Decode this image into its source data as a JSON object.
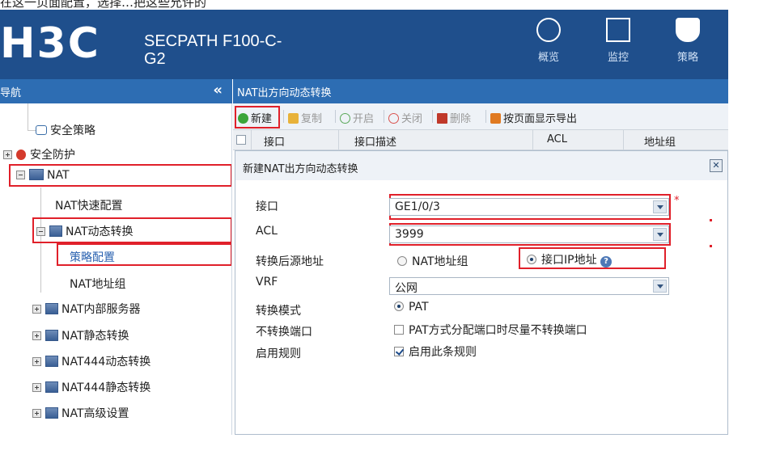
{
  "top_text": "在这一页面配置，选择…把这些允许的",
  "header": {
    "logo": "H3C",
    "product_line1": "SECPATH F100-C-",
    "product_line2": "G2",
    "nav": [
      {
        "label": "概览",
        "icon": "gauge-icon"
      },
      {
        "label": "监控",
        "icon": "monitor-icon"
      },
      {
        "label": "策略",
        "icon": "shield-icon"
      }
    ]
  },
  "sidebar": {
    "title": "导航",
    "collapse_glyph": "«",
    "items": [
      {
        "label": "安全策略"
      },
      {
        "label": "安全防护"
      },
      {
        "label": "NAT"
      },
      {
        "label": "NAT快速配置"
      },
      {
        "label": "NAT动态转换"
      },
      {
        "label": "策略配置"
      },
      {
        "label": "NAT地址组"
      },
      {
        "label": "NAT内部服务器"
      },
      {
        "label": "NAT静态转换"
      },
      {
        "label": "NAT444动态转换"
      },
      {
        "label": "NAT444静态转换"
      },
      {
        "label": "NAT高级设置"
      }
    ]
  },
  "main": {
    "title": "NAT出方向动态转换",
    "toolbar": {
      "new": "新建",
      "copy": "复制",
      "enable": "开启",
      "disable": "关闭",
      "delete": "删除",
      "export": "按页面显示导出"
    },
    "columns": [
      "接口",
      "接口描述",
      "ACL",
      "地址组"
    ]
  },
  "dialog": {
    "title": "新建NAT出方向动态转换",
    "close": "✕",
    "required_mark": "*",
    "fields": {
      "interface": {
        "label": "接口",
        "value": "GE1/0/3"
      },
      "acl": {
        "label": "ACL",
        "value": "3999"
      },
      "src_after": {
        "label": "转换后源地址",
        "option1": "NAT地址组",
        "option2": "接口IP地址",
        "selected": "接口IP地址",
        "help": "?"
      },
      "vrf": {
        "label": "VRF",
        "value": "公网"
      },
      "mode": {
        "label": "转换模式",
        "option": "PAT"
      },
      "no_port": {
        "label": "不转换端口",
        "option": "PAT方式分配端口时尽量不转换端口",
        "checked": false
      },
      "enable_rule": {
        "label": "启用规则",
        "option": "启用此条规则",
        "checked": true
      }
    }
  },
  "colors": {
    "header_bg": "#1f4f8c",
    "bar_bg": "#2d6db3",
    "highlight_border": "#e0202a",
    "link": "#2a62b0"
  }
}
